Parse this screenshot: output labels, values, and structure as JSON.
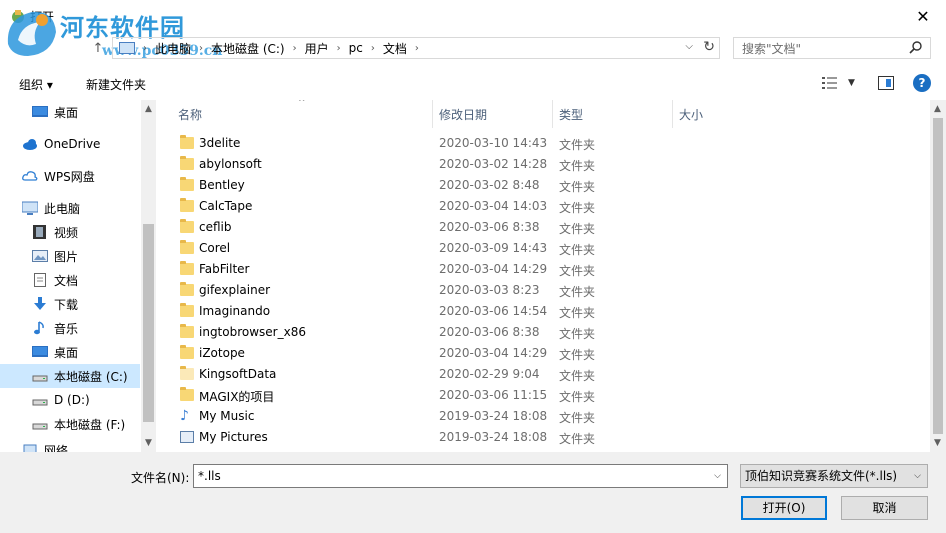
{
  "window": {
    "title": "打开",
    "close_glyph": "✕",
    "watermark_main": "河东软件园",
    "watermark_sub": "www.pc0359.cn"
  },
  "address": {
    "back_glyph": "↑",
    "crumbs": [
      "此电脑",
      "本地磁盘 (C:)",
      "用户",
      "pc",
      "文档"
    ],
    "search_placeholder": "搜索\"文档\""
  },
  "toolbar": {
    "organize": "组织 ▾",
    "new_folder": "新建文件夹",
    "help": "?"
  },
  "nav": {
    "items": [
      {
        "label": "桌面",
        "icon": "desktop-icon"
      },
      {
        "label": "OneDrive",
        "icon": "cloud-icon"
      },
      {
        "label": "WPS网盘",
        "icon": "wps-cloud-icon"
      },
      {
        "label": "此电脑",
        "icon": "computer-icon"
      },
      {
        "label": "视频",
        "icon": "video-icon"
      },
      {
        "label": "图片",
        "icon": "picture-icon"
      },
      {
        "label": "文档",
        "icon": "document-icon"
      },
      {
        "label": "下载",
        "icon": "download-icon"
      },
      {
        "label": "音乐",
        "icon": "music-icon"
      },
      {
        "label": "桌面",
        "icon": "desktop-icon"
      },
      {
        "label": "本地磁盘 (C:)",
        "icon": "drive-icon"
      },
      {
        "label": "D (D:)",
        "icon": "drive-icon"
      },
      {
        "label": "本地磁盘 (F:)",
        "icon": "drive-icon"
      },
      {
        "label": "网络",
        "icon": "network-icon"
      }
    ],
    "selected_index": 10
  },
  "columns": {
    "name": "名称",
    "date": "修改日期",
    "type": "类型",
    "size": "大小"
  },
  "files": [
    {
      "name": "3delite",
      "date": "2020-03-10 14:43",
      "type": "文件夹",
      "icon": "folder"
    },
    {
      "name": "abylonsoft",
      "date": "2020-03-02 14:28",
      "type": "文件夹",
      "icon": "folder"
    },
    {
      "name": "Bentley",
      "date": "2020-03-02 8:48",
      "type": "文件夹",
      "icon": "folder"
    },
    {
      "name": "CalcTape",
      "date": "2020-03-04 14:03",
      "type": "文件夹",
      "icon": "folder"
    },
    {
      "name": "ceflib",
      "date": "2020-03-06 8:38",
      "type": "文件夹",
      "icon": "folder"
    },
    {
      "name": "Corel",
      "date": "2020-03-09 14:43",
      "type": "文件夹",
      "icon": "folder"
    },
    {
      "name": "FabFilter",
      "date": "2020-03-04 14:29",
      "type": "文件夹",
      "icon": "folder"
    },
    {
      "name": "gifexplainer",
      "date": "2020-03-03 8:23",
      "type": "文件夹",
      "icon": "folder"
    },
    {
      "name": "Imaginando",
      "date": "2020-03-06 14:54",
      "type": "文件夹",
      "icon": "folder"
    },
    {
      "name": "ingtobrowser_x86",
      "date": "2020-03-06 8:38",
      "type": "文件夹",
      "icon": "folder"
    },
    {
      "name": "iZotope",
      "date": "2020-03-04 14:29",
      "type": "文件夹",
      "icon": "folder"
    },
    {
      "name": "KingsoftData",
      "date": "2020-02-29 9:04",
      "type": "文件夹",
      "icon": "folder-light"
    },
    {
      "name": "MAGIX的项目",
      "date": "2020-03-06 11:15",
      "type": "文件夹",
      "icon": "folder"
    },
    {
      "name": "My Music",
      "date": "2019-03-24 18:08",
      "type": "文件夹",
      "icon": "music"
    },
    {
      "name": "My Pictures",
      "date": "2019-03-24 18:08",
      "type": "文件夹",
      "icon": "pictures"
    }
  ],
  "bottom": {
    "filename_label": "文件名(N):",
    "filename_value": "*.lls",
    "filter_value": "顶伯知识竞赛系统文件(*.lls)",
    "open_label": "打开(O)",
    "cancel_label": "取消"
  }
}
